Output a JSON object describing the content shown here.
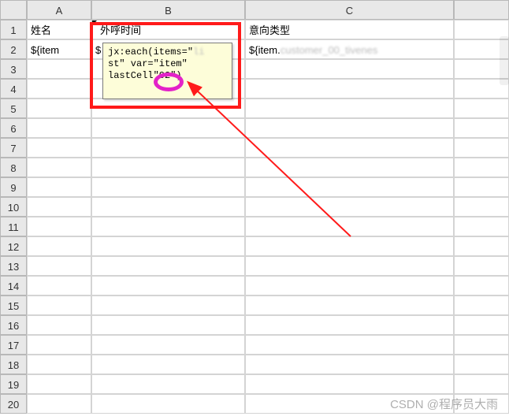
{
  "columns": [
    "A",
    "B",
    "C"
  ],
  "row_count": 20,
  "headers": {
    "A1": "姓名",
    "B1": "外呼时间",
    "C1": "意向类型"
  },
  "data_row": {
    "A2": "${item",
    "B2_prefix": "$",
    "C2_prefix": "${item.",
    "C2_blurred": "customer_00_tivenes"
  },
  "comment": {
    "line1_prefix": "jx:each(items=\"",
    "line1_blurred": "li",
    "line2": "st\" var=\"item\"",
    "line3_prefix": "lastCell",
    "line3_circled": "\"O2\")"
  },
  "watermark": "CSDN @程序员大雨"
}
